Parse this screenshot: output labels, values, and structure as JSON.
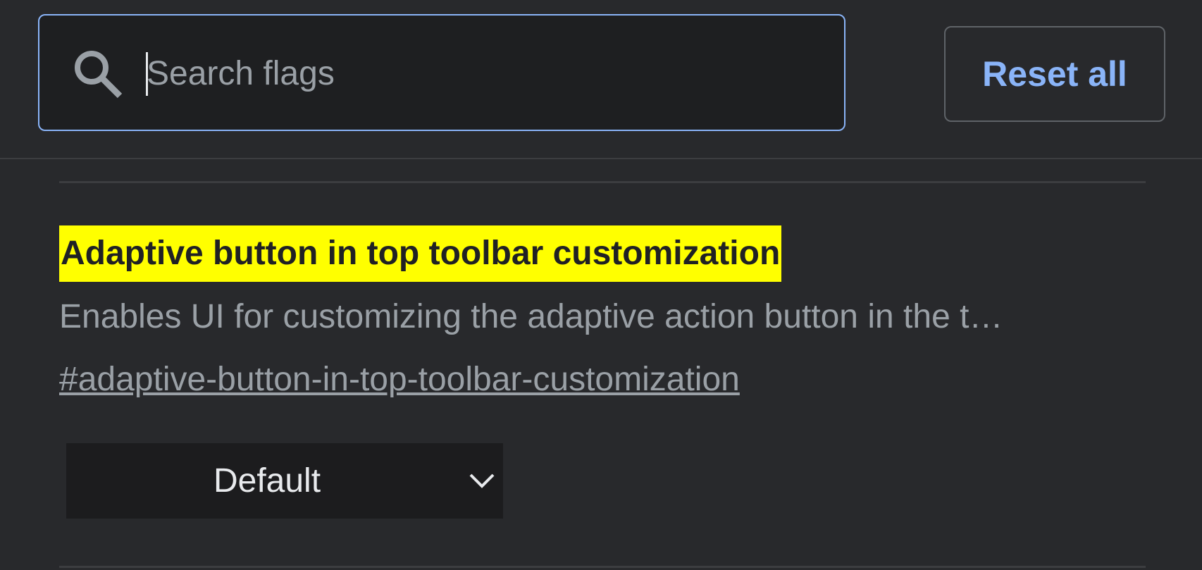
{
  "search": {
    "placeholder": "Search flags",
    "value": "",
    "icon": "search-icon"
  },
  "toolbar": {
    "reset_label": "Reset all"
  },
  "flag": {
    "title": "Adaptive button in top toolbar customization",
    "description": "Enables UI for customizing the adaptive action button in the t…",
    "anchor": "#adaptive-button-in-top-toolbar-customization",
    "select_value": "Default",
    "select_icon": "chevron-down-icon"
  },
  "colors": {
    "background": "#28292c",
    "accent": "#8ab4f8",
    "highlight": "#ffff00",
    "muted_text": "#9aa0a6"
  }
}
